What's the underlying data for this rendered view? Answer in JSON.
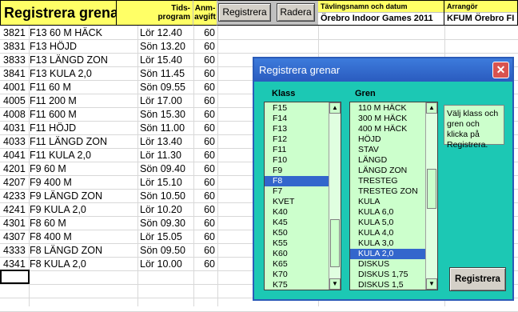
{
  "header": {
    "title": "Registrera grenar",
    "tids_label": "Tids-\nprogram",
    "tids_line1": "Tids-",
    "tids_line2": "program",
    "anm_line1": "Anm-",
    "anm_line2": "avgift",
    "register_button": "Registrera",
    "delete_button": "Radera",
    "competition_label": "Tävlingsnamn och datum",
    "competition_value": "Örebro Indoor Games 2011",
    "organizer_label": "Arrangör",
    "organizer_value": "KFUM Örebro FI"
  },
  "rows": [
    {
      "id": "3821",
      "name": "F13  60 M HÄCK",
      "time": "Lör 12.40",
      "fee": "60"
    },
    {
      "id": "3831",
      "name": "F13  HÖJD",
      "time": "Sön 13.20",
      "fee": "60"
    },
    {
      "id": "3833",
      "name": "F13  LÄNGD ZON",
      "time": "Lör 15.40",
      "fee": "60"
    },
    {
      "id": "3841",
      "name": "F13  KULA 2,0",
      "time": "Sön 11.45",
      "fee": "60"
    },
    {
      "id": "4001",
      "name": "F11  60 M",
      "time": "Sön 09.55",
      "fee": "60"
    },
    {
      "id": "4005",
      "name": "F11  200 M",
      "time": "Lör 17.00",
      "fee": "60"
    },
    {
      "id": "4008",
      "name": "F11  600 M",
      "time": "Sön 15.30",
      "fee": "60"
    },
    {
      "id": "4031",
      "name": "F11  HÖJD",
      "time": "Sön 11.00",
      "fee": "60"
    },
    {
      "id": "4033",
      "name": "F11  LÄNGD ZON",
      "time": "Lör 13.40",
      "fee": "60"
    },
    {
      "id": "4041",
      "name": "F11  KULA 2,0",
      "time": "Lör 11.30",
      "fee": "60"
    },
    {
      "id": "4201",
      "name": "F9  60 M",
      "time": "Sön 09.40",
      "fee": "60"
    },
    {
      "id": "4207",
      "name": "F9  400 M",
      "time": "Lör 15.10",
      "fee": "60"
    },
    {
      "id": "4233",
      "name": "F9  LÄNGD ZON",
      "time": "Sön 10.50",
      "fee": "60"
    },
    {
      "id": "4241",
      "name": "F9  KULA 2,0",
      "time": "Lör 10.20",
      "fee": "60"
    },
    {
      "id": "4301",
      "name": "F8  60 M",
      "time": "Sön 09.30",
      "fee": "60"
    },
    {
      "id": "4307",
      "name": "F8  400 M",
      "time": "Lör 15.05",
      "fee": "60"
    },
    {
      "id": "4333",
      "name": "F8  LÄNGD ZON",
      "time": "Sön 09.50",
      "fee": "60"
    },
    {
      "id": "4341",
      "name": "F8  KULA 2,0",
      "time": "Lör 10.00",
      "fee": "60"
    }
  ],
  "dialog": {
    "title": "Registrera grenar",
    "klass_label": "Klass",
    "gren_label": "Gren",
    "klass_items": [
      "F15",
      "F14",
      "F13",
      "F12",
      "F11",
      "F10",
      "F9",
      "F8",
      "F7",
      "KVET",
      "K40",
      "K45",
      "K50",
      "K55",
      "K60",
      "K65",
      "K70",
      "K75"
    ],
    "klass_selected": "F8",
    "gren_items": [
      "110 M HÄCK",
      "300 M HÄCK",
      "400 M HÄCK",
      "HÖJD",
      "STAV",
      "LÄNGD",
      "LÄNGD ZON",
      "TRESTEG",
      "TRESTEG ZON",
      "KULA",
      "KULA 6,0",
      "KULA 5,0",
      "KULA 4,0",
      "KULA 3,0",
      "KULA 2,0",
      "DISKUS",
      "DISKUS 1,75",
      "DISKUS 1,5"
    ],
    "gren_selected": "KULA 2,0",
    "help_text": "Välj klass och gren och klicka på Registrera.",
    "register_button": "Registrera",
    "close_icon": "close-icon"
  },
  "colors": {
    "header_yellow": "#ffff66",
    "list_green": "#ccffcc",
    "dialog_teal": "#1cc8b4",
    "selection_blue": "#3366cc",
    "titlebar_blue": "#3c78d8"
  }
}
